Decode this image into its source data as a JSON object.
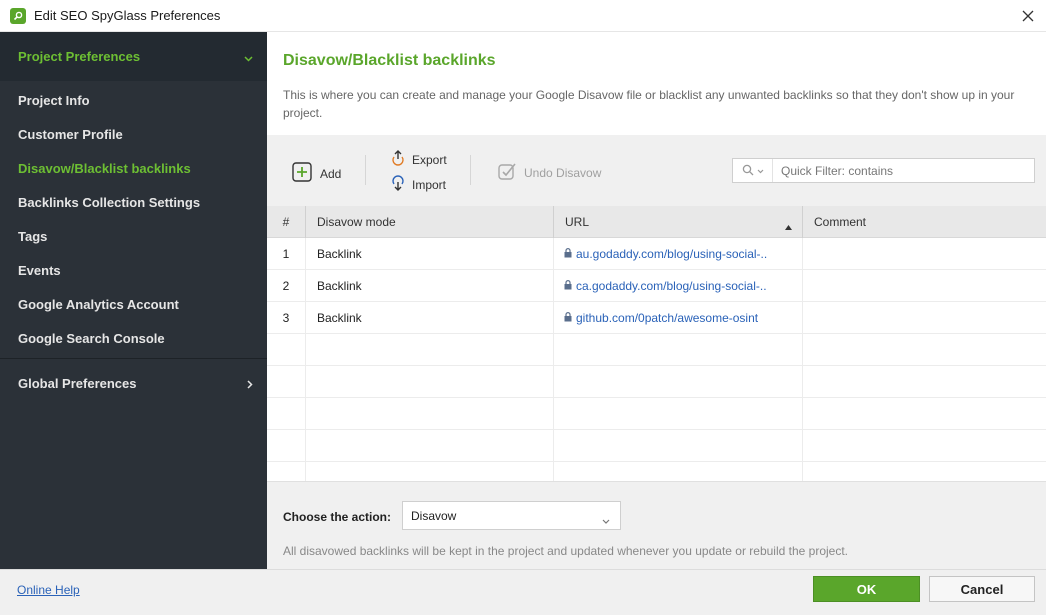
{
  "window": {
    "title": "Edit SEO SpyGlass Preferences",
    "app_icon": "spyglass-logo-icon",
    "close_icon": "close-icon"
  },
  "colors": {
    "accent_green": "#5aa62b",
    "sidebar_bg": "#2b3138",
    "link_blue": "#2a62b8"
  },
  "sidebar": {
    "section_label": "Project Preferences",
    "section_icon": "chevron-down-icon",
    "items": [
      {
        "label": "Project Info",
        "active": false
      },
      {
        "label": "Customer Profile",
        "active": false
      },
      {
        "label": "Disavow/Blacklist backlinks",
        "active": true
      },
      {
        "label": "Backlinks Collection Settings",
        "active": false
      },
      {
        "label": "Tags",
        "active": false
      },
      {
        "label": "Events",
        "active": false
      },
      {
        "label": "Google Analytics Account",
        "active": false
      },
      {
        "label": "Google Search Console",
        "active": false
      }
    ],
    "global_label": "Global Preferences",
    "global_icon": "chevron-right-icon"
  },
  "main": {
    "title": "Disavow/Blacklist backlinks",
    "description": "This is where you can create and manage your Google Disavow file or blacklist any unwanted backlinks so that they don't show up in your project."
  },
  "toolbar": {
    "add_label": "Add",
    "add_icon": "plus-square-icon",
    "export_label": "Export",
    "export_icon": "export-icon",
    "import_label": "Import",
    "import_icon": "import-icon",
    "undo_label": "Undo Disavow",
    "undo_icon": "undo-disavow-icon",
    "filter_icon": "search-icon",
    "filter_placeholder": "Quick Filter: contains"
  },
  "table": {
    "columns": [
      "#",
      "Disavow mode",
      "URL",
      "Comment"
    ],
    "sort_column": "URL",
    "sort_icon": "sort-asc-icon",
    "rows": [
      {
        "num": "1",
        "mode": "Backlink",
        "url": "au.godaddy.com/blog/using-social-..",
        "comment": ""
      },
      {
        "num": "2",
        "mode": "Backlink",
        "url": "ca.godaddy.com/blog/using-social-..",
        "comment": ""
      },
      {
        "num": "3",
        "mode": "Backlink",
        "url": "github.com/0patch/awesome-osint",
        "comment": ""
      }
    ],
    "lock_icon": "lock-icon"
  },
  "action": {
    "label": "Choose the action:",
    "selected": "Disavow",
    "note": "All disavowed backlinks will be kept in the project and updated whenever you update or rebuild the project."
  },
  "footer": {
    "help_link": "Online Help",
    "ok_label": "OK",
    "cancel_label": "Cancel"
  }
}
